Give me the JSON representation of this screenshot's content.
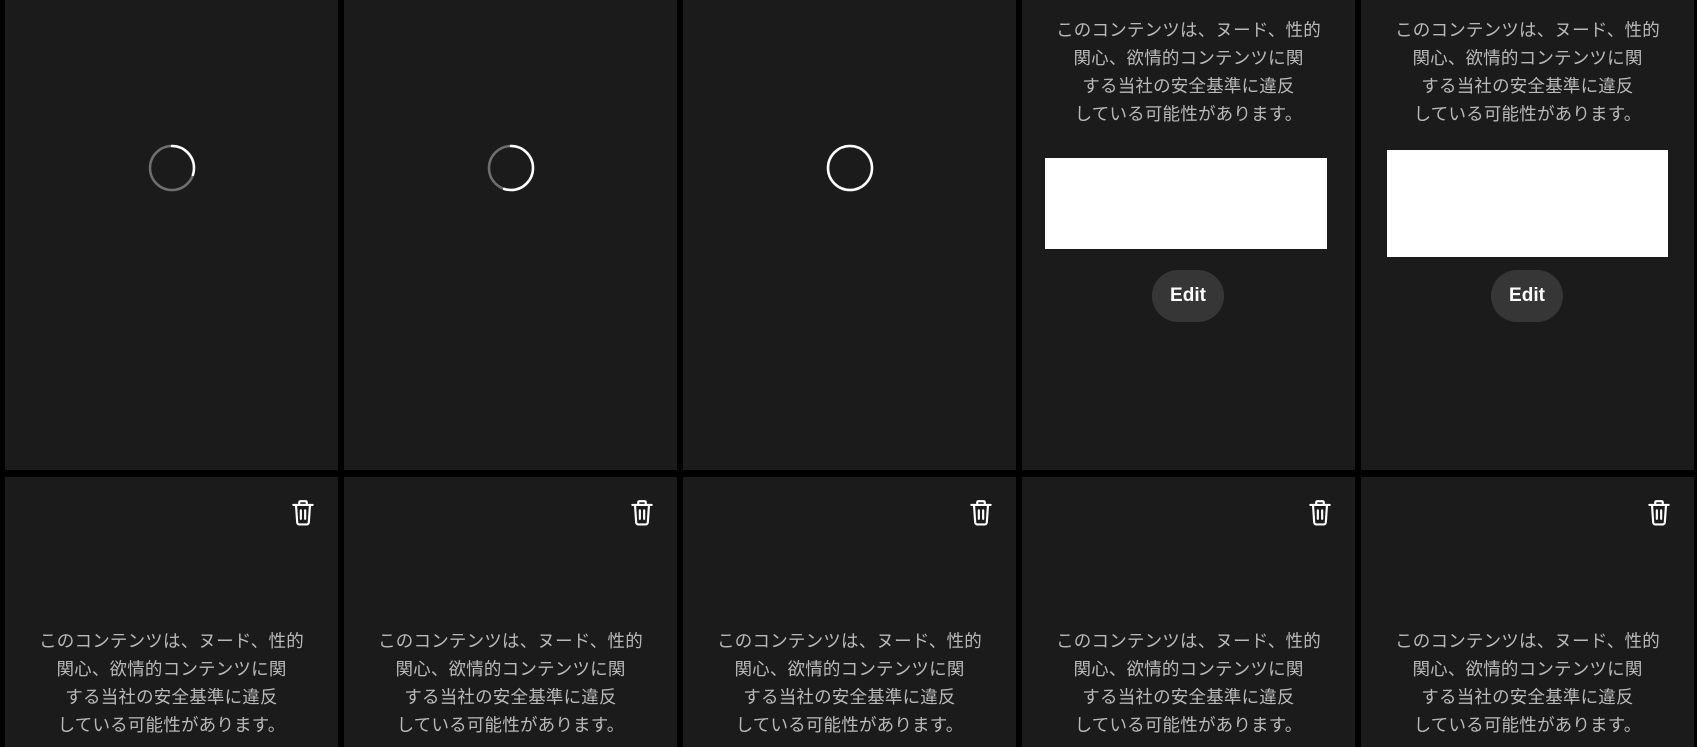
{
  "warning_lines": [
    "このコンテンツは、ヌード、性的",
    "関心、欲情的コンテンツに関",
    "する当社の安全基準に違反",
    "している可能性があります。"
  ],
  "edit_label": "Edit",
  "icons": {
    "loading": "loading-spinner-icon",
    "delete": "trash-icon"
  },
  "colors": {
    "page_background": "#000000",
    "tile_background": "#1b1b1b",
    "warning_text": "#b9b9b9",
    "edit_button_background": "#363636",
    "spinner_track": "#6e6e6e",
    "spinner_arc": "#ffffff"
  },
  "tiles_top_row": [
    {
      "state": "loading",
      "spinner_progress": 0.3
    },
    {
      "state": "loading",
      "spinner_progress": 0.55
    },
    {
      "state": "loading",
      "spinner_progress": 1.0
    },
    {
      "state": "flagged-with-edit"
    },
    {
      "state": "flagged-with-edit"
    }
  ],
  "tiles_bottom_row": [
    {
      "state": "flagged-with-delete"
    },
    {
      "state": "flagged-with-delete"
    },
    {
      "state": "flagged-with-delete"
    },
    {
      "state": "flagged-with-delete"
    },
    {
      "state": "flagged-with-delete"
    }
  ]
}
